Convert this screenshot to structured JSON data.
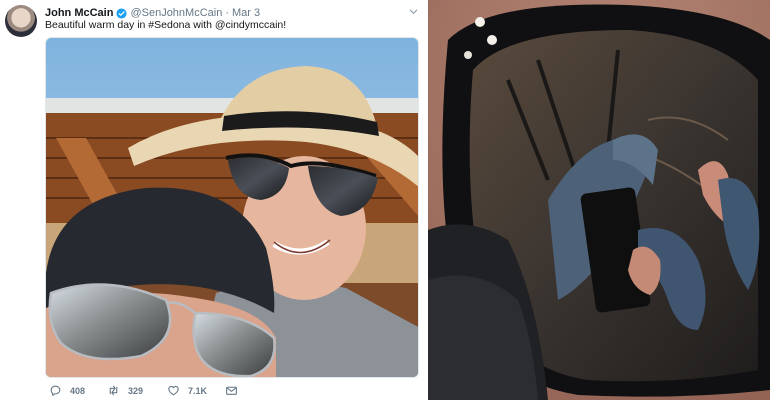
{
  "tweet": {
    "display_name": "John McCain",
    "handle": "@SenJohnMcCain",
    "separator": "·",
    "date": "Mar 3",
    "text": "Beautiful warm day in #Sedona with @cindymccain!",
    "verified": true,
    "actions": {
      "reply_count": "408",
      "retweet_count": "329",
      "like_count": "7.1K"
    }
  },
  "icons": {
    "verified": "verified-badge-icon",
    "caret": "chevron-down-icon",
    "reply": "reply-icon",
    "retweet": "retweet-icon",
    "like": "heart-icon",
    "dm": "envelope-icon"
  },
  "colors": {
    "text_primary": "#14171a",
    "text_secondary": "#657786",
    "verified_blue": "#1da1f2"
  }
}
